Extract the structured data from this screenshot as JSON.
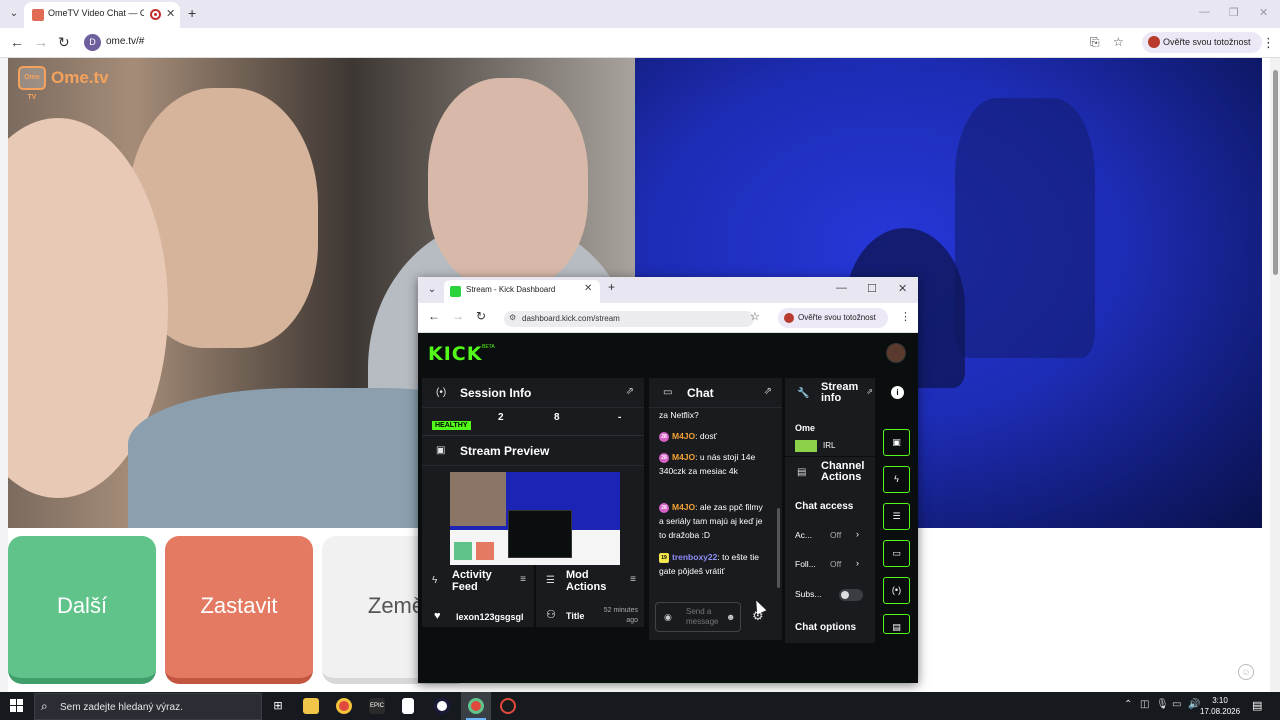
{
  "browser": {
    "tab_title": "OmeTV Video Chat — Ome",
    "url": "ome.tv/#",
    "site_initial": "D",
    "verify_label": "Ověřte svou totožnost"
  },
  "ome": {
    "logo_badge": "Ome TV",
    "logo_text": "Ome.tv",
    "buttons": {
      "next": "Další",
      "stop": "Zastavit",
      "country": "Země"
    }
  },
  "kick_window": {
    "tab_title": "Stream - Kick Dashboard",
    "url": "dashboard.kick.com/stream",
    "verify_label": "Ověřte svou totožnost",
    "logo": "KICK",
    "logo_badge": "BETA",
    "session_info": {
      "title": "Session Info",
      "stats": [
        "2",
        "8",
        "-"
      ],
      "health": "HEALTHY"
    },
    "stream_preview": {
      "title": "Stream Preview"
    },
    "activity_feed": {
      "title": "Activity Feed",
      "row": "lexon123gsgsgl"
    },
    "mod_actions": {
      "title": "Mod Actions",
      "row_title": "Title",
      "row_time": "52 minutes ago"
    },
    "chat": {
      "title": "Chat",
      "messages": [
        {
          "badge": "",
          "user": "",
          "text": "za Netflix?"
        },
        {
          "badge": "28",
          "user": "M4JO",
          "text": "dosť"
        },
        {
          "badge": "28",
          "user": "M4JO",
          "text": "u nás stojí 14e 340czk za mesiac 4k"
        },
        {
          "badge": "28",
          "user": "M4JO",
          "text": "ale zas ppč filmy a seriály tam majú aj keď je to dražoba :D"
        },
        {
          "badge": "19",
          "user": "trenboxy22",
          "text": "to ešte tie gate pôjdeš vrátiť"
        }
      ],
      "input_placeholder": "Send a message"
    },
    "stream_info": {
      "title": "Stream info",
      "stream_title": "Ome",
      "category": "IRL"
    },
    "channel_actions": {
      "title": "Channel Actions",
      "section_chat_access": "Chat access",
      "items": [
        {
          "label": "Ac...",
          "value": "Off"
        },
        {
          "label": "Foll...",
          "value": "Off"
        },
        {
          "label": "Subs..."
        }
      ],
      "section_chat_options": "Chat options"
    }
  },
  "taskbar": {
    "search_placeholder": "Sem zadejte hledaný výraz.",
    "time": "3:10",
    "date": "17.08.2026"
  }
}
